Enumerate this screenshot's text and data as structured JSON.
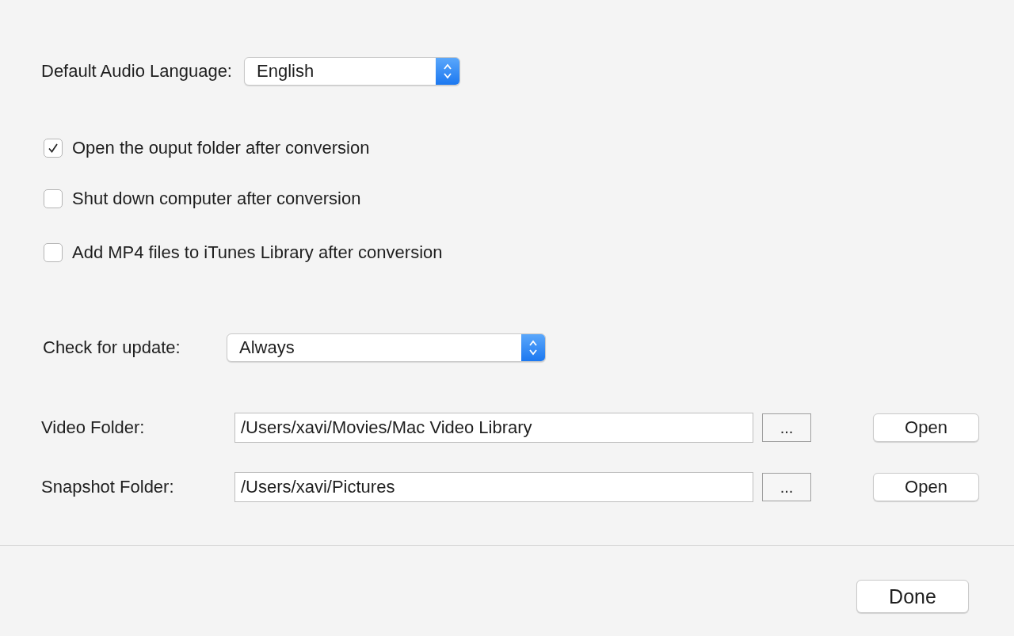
{
  "audio_language": {
    "label": "Default Audio Language:",
    "value": "English"
  },
  "options": [
    {
      "label": "Open the ouput folder after conversion",
      "checked": true
    },
    {
      "label": "Shut down computer after conversion",
      "checked": false
    },
    {
      "label": "Add MP4 files to iTunes Library after conversion",
      "checked": false
    }
  ],
  "update": {
    "label": "Check for update:",
    "value": "Always"
  },
  "folders": [
    {
      "label": "Video Folder:",
      "value": "/Users/xavi/Movies/Mac Video Library",
      "browse": "...",
      "open": "Open"
    },
    {
      "label": "Snapshot Folder:",
      "value": "/Users/xavi/Pictures",
      "browse": "...",
      "open": "Open"
    }
  ],
  "done": "Done"
}
